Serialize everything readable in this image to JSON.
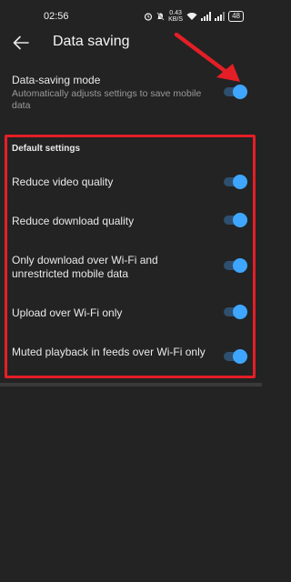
{
  "status_bar": {
    "time": "02:56",
    "net_speed": "0.43\nKB/S",
    "battery": "48"
  },
  "header": {
    "title": "Data saving"
  },
  "data_saving_mode": {
    "label": "Data-saving mode",
    "description": "Automatically adjusts settings to save mobile data",
    "enabled": true
  },
  "default_settings": {
    "header": "Default settings",
    "items": [
      {
        "label": "Reduce video quality",
        "enabled": true
      },
      {
        "label": "Reduce download quality",
        "enabled": true
      },
      {
        "label": "Only download over Wi-Fi and unrestricted mobile data",
        "enabled": true
      },
      {
        "label": "Upload over Wi-Fi only",
        "enabled": true
      },
      {
        "label": "Muted playback in feeds over Wi-Fi only",
        "enabled": true
      }
    ]
  },
  "colors": {
    "background": "#232323",
    "toggle_on": "#3ea6ff",
    "annotation_red": "#e41e26"
  }
}
